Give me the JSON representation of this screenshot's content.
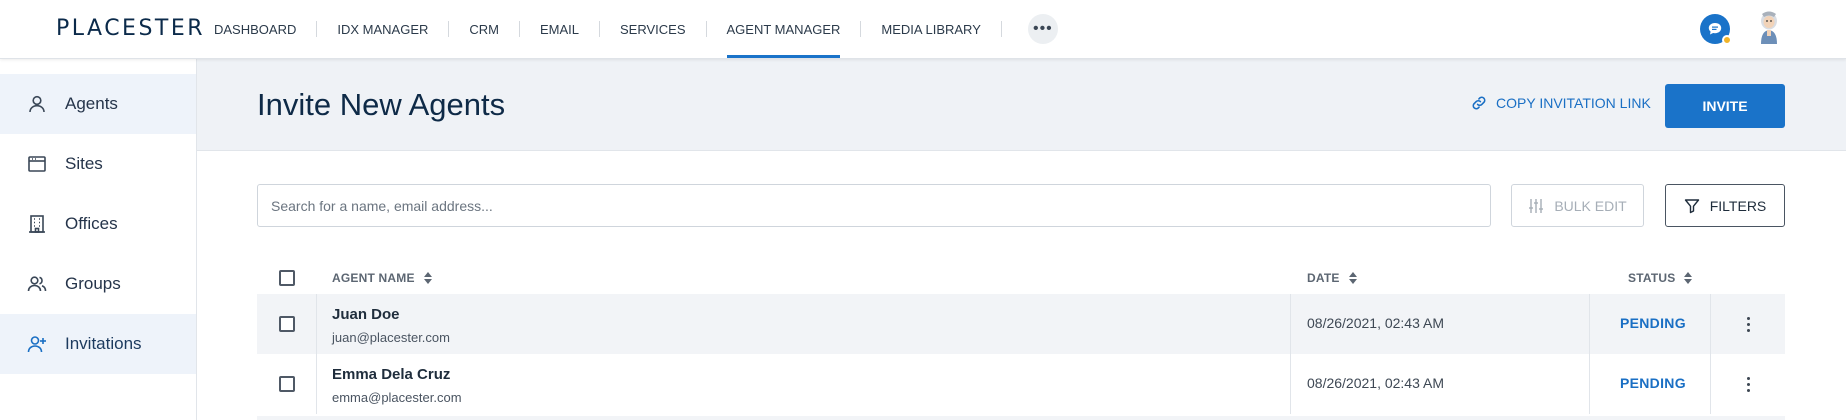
{
  "brand": {
    "logo_text": "PLACESTER",
    "accent": "#1a73c9"
  },
  "nav": {
    "items": [
      {
        "label": "DASHBOARD",
        "active": false
      },
      {
        "label": "IDX MANAGER",
        "active": false
      },
      {
        "label": "CRM",
        "active": false
      },
      {
        "label": "EMAIL",
        "active": false
      },
      {
        "label": "SERVICES",
        "active": false
      },
      {
        "label": "AGENT MANAGER",
        "active": true
      },
      {
        "label": "MEDIA LIBRARY",
        "active": false
      }
    ],
    "more_icon": "ellipsis-icon",
    "more_label": "•••"
  },
  "sidebar": {
    "items": [
      {
        "label": "Agents",
        "icon": "user-icon",
        "highlighted": true
      },
      {
        "label": "Sites",
        "icon": "browser-icon",
        "highlighted": false
      },
      {
        "label": "Offices",
        "icon": "building-icon",
        "highlighted": false
      },
      {
        "label": "Groups",
        "icon": "users-icon",
        "highlighted": false
      },
      {
        "label": "Invitations",
        "icon": "user-plus-icon",
        "highlighted": true,
        "active": true
      }
    ]
  },
  "header": {
    "title": "Invite New Agents",
    "copy_link_label": "COPY INVITATION LINK",
    "invite_label": "INVITE"
  },
  "toolbar": {
    "search_placeholder": "Search for a name, email address...",
    "bulk_edit_label": "BULK EDIT",
    "filters_label": "FILTERS"
  },
  "table": {
    "columns": {
      "name": "AGENT NAME",
      "date": "DATE",
      "status": "STATUS"
    },
    "rows": [
      {
        "name": "Juan Doe",
        "email": "juan@placester.com",
        "date": "08/26/2021, 02:43 AM",
        "status": "PENDING"
      },
      {
        "name": "Emma Dela Cruz",
        "email": "emma@placester.com",
        "date": "08/26/2021, 02:43 AM",
        "status": "PENDING"
      }
    ]
  }
}
